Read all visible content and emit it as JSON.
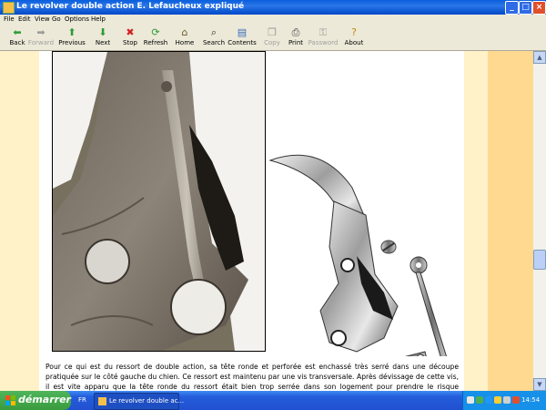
{
  "window": {
    "title": "Le revolver double action E. Lefaucheux expliqué"
  },
  "menu": [
    "File",
    "Edit",
    "View",
    "Go",
    "Options",
    "Help"
  ],
  "toolbar": [
    {
      "label": "Back",
      "icon": "back-arrow-icon",
      "glyph": "⬅",
      "enabled": true,
      "color": "#2a9d35"
    },
    {
      "label": "Forward",
      "icon": "forward-arrow-icon",
      "glyph": "➡",
      "enabled": false,
      "color": "#9a9a9a"
    },
    {
      "label": "Previous",
      "icon": "up-arrow-icon",
      "glyph": "⬆",
      "enabled": true,
      "color": "#2a9d35"
    },
    {
      "label": "Next",
      "icon": "down-arrow-icon",
      "glyph": "⬇",
      "enabled": true,
      "color": "#2a9d35"
    },
    {
      "label": "Stop",
      "icon": "stop-icon",
      "glyph": "✖",
      "enabled": true,
      "color": "#d62020"
    },
    {
      "label": "Refresh",
      "icon": "refresh-icon",
      "glyph": "⟳",
      "enabled": true,
      "color": "#2a9d35"
    },
    {
      "label": "Home",
      "icon": "home-icon",
      "glyph": "⌂",
      "enabled": true,
      "color": "#6a5a2a"
    },
    {
      "label": "Search",
      "icon": "search-icon",
      "glyph": "⌕",
      "enabled": true,
      "color": "#333333"
    },
    {
      "label": "Contents",
      "icon": "contents-icon",
      "glyph": "▤",
      "enabled": true,
      "color": "#3a6ab8"
    },
    {
      "label": "Copy",
      "icon": "copy-icon",
      "glyph": "❐",
      "enabled": false,
      "color": "#9a9a9a"
    },
    {
      "label": "Print",
      "icon": "print-icon",
      "glyph": "⎙",
      "enabled": true,
      "color": "#444444"
    },
    {
      "label": "Password",
      "icon": "key-icon",
      "glyph": "⚿",
      "enabled": false,
      "color": "#9a9a9a"
    },
    {
      "label": "About",
      "icon": "about-icon",
      "glyph": "?",
      "enabled": true,
      "color": "#c08a10"
    }
  ],
  "content": {
    "paragraph": "Pour ce qui est du ressort de double action, sa tête ronde et perforée est enchassé très serré dans une découpe pratiquée sur le côté gauche du chien. Ce ressort est maintenu par une vis transversale. Après dévissage de cette vis, il est vite apparu que la tête ronde du ressort était bien trop serrée dans son logement pour prendre le risque d'essayer de démonter le ressort."
  },
  "taskbar": {
    "start_label": "démarrer",
    "language": "FR",
    "task_label": "Le revolver double ac...",
    "clock": "14:54"
  }
}
